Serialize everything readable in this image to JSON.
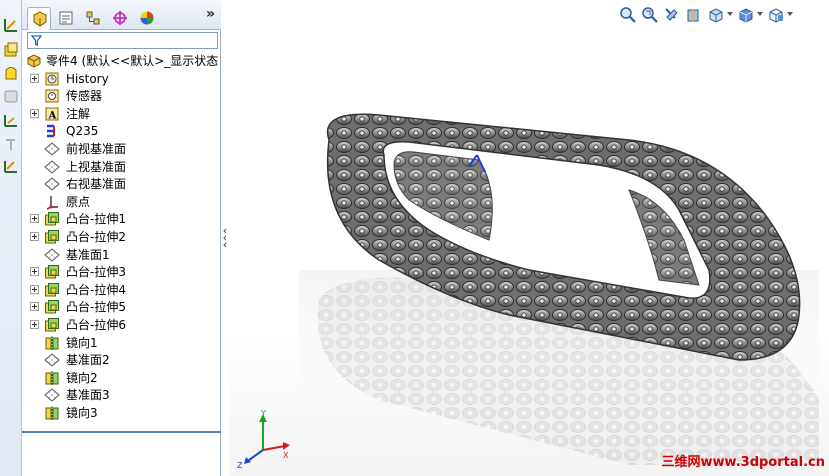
{
  "command_strip": {
    "icons": [
      "sketch-icon",
      "extrude-boss-icon",
      "revolve-icon",
      "shell-icon",
      "reference-geometry-icon",
      "move-icon",
      "smart-dimension-icon"
    ]
  },
  "feature_manager": {
    "tabs": [
      {
        "name": "feature-tree-tab",
        "icon": "feature-tree-icon",
        "active": true
      },
      {
        "name": "property-manager-tab",
        "icon": "property-manager-icon",
        "active": false
      },
      {
        "name": "configuration-manager-tab",
        "icon": "configuration-icon",
        "active": false
      },
      {
        "name": "dimxpert-tab",
        "icon": "target-icon",
        "active": false
      },
      {
        "name": "display-manager-tab",
        "icon": "appearance-icon",
        "active": false
      }
    ],
    "more": "»",
    "filter_placeholder": "",
    "root": {
      "label": "零件4  (默认<<默认>_显示状态",
      "icon": "part-icon"
    },
    "items": [
      {
        "label": "History",
        "icon": "history-icon",
        "expandable": true
      },
      {
        "label": "传感器",
        "icon": "sensor-icon",
        "expandable": false
      },
      {
        "label": "注解",
        "icon": "annotation-icon",
        "expandable": true
      },
      {
        "label": "Q235",
        "icon": "material-icon",
        "expandable": false
      },
      {
        "label": "前视基准面",
        "icon": "plane-icon",
        "expandable": false
      },
      {
        "label": "上视基准面",
        "icon": "plane-icon",
        "expandable": false
      },
      {
        "label": "右视基准面",
        "icon": "plane-icon",
        "expandable": false
      },
      {
        "label": "原点",
        "icon": "origin-icon",
        "expandable": false
      },
      {
        "label": "凸台-拉伸1",
        "icon": "boss-extrude-icon",
        "expandable": true
      },
      {
        "label": "凸台-拉伸2",
        "icon": "boss-extrude-icon",
        "expandable": true
      },
      {
        "label": "基准面1",
        "icon": "plane-icon",
        "expandable": false
      },
      {
        "label": "凸台-拉伸3",
        "icon": "boss-extrude-icon",
        "expandable": true
      },
      {
        "label": "凸台-拉伸4",
        "icon": "boss-extrude-icon",
        "expandable": true
      },
      {
        "label": "凸台-拉伸5",
        "icon": "boss-extrude-icon",
        "expandable": true
      },
      {
        "label": "凸台-拉伸6",
        "icon": "boss-extrude-icon",
        "expandable": true
      },
      {
        "label": "镜向1",
        "icon": "mirror-icon",
        "expandable": false
      },
      {
        "label": "基准面2",
        "icon": "plane-icon",
        "expandable": false
      },
      {
        "label": "镜向2",
        "icon": "mirror-icon",
        "expandable": false
      },
      {
        "label": "基准面3",
        "icon": "plane-icon",
        "expandable": false
      },
      {
        "label": "镜向3",
        "icon": "mirror-icon",
        "expandable": false
      }
    ]
  },
  "headsup_toolbar": {
    "icons": [
      "zoom-to-fit-icon",
      "zoom-to-area-icon",
      "previous-view-icon",
      "section-view-icon",
      "view-orientation-icon",
      "display-style-icon",
      "hide-show-icon"
    ]
  },
  "triad": {
    "x": "X",
    "y": "Y",
    "z": "Z"
  },
  "watermark": "三维网www.3dportal.cn",
  "colors": {
    "accent": "#5a7fb8",
    "panel_bg": "#ffffff",
    "strip_bg": "#e6edf6",
    "watermark": "#d10000"
  }
}
